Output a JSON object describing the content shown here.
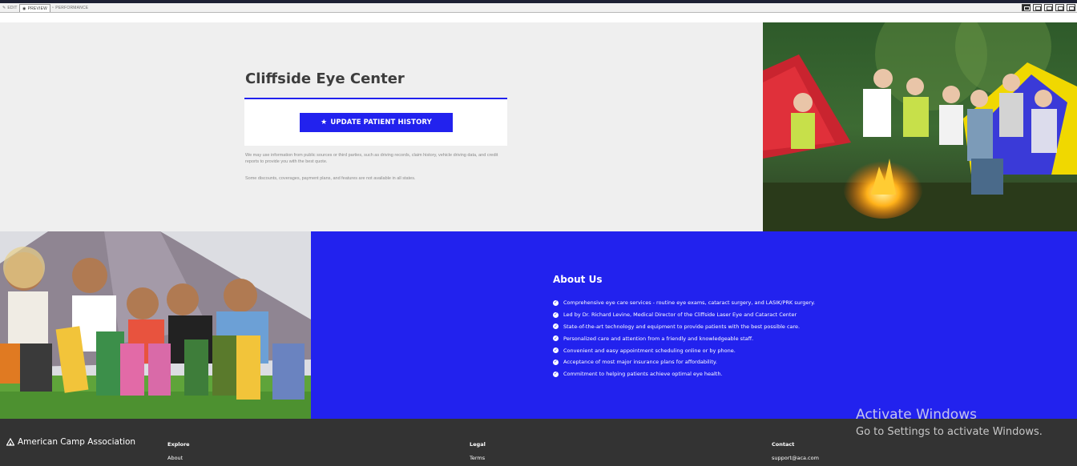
{
  "editor": {
    "tabs": [
      {
        "label": "EDIT",
        "icon": "pencil-icon"
      },
      {
        "label": "PREVIEW",
        "icon": "eye-icon",
        "active": true
      },
      {
        "label": "PERFORMANCE",
        "icon": "gauge-icon"
      }
    ],
    "device_icons": [
      "desktop-icon",
      "tablet-icon",
      "laptop-icon",
      "monitor-icon",
      "phone-icon"
    ]
  },
  "hero": {
    "title": "Cliffside Eye Center",
    "cta_label": "UPDATE PATIENT HISTORY",
    "cta_icon": "star-icon",
    "disclaimer1": "We may use information from public sources or third parties, such as driving records, claim history, vehicle driving data, and credit reports to provide you with the best quote.",
    "disclaimer2": "Some discounts, coverages, payment plans, and features are not available in all states."
  },
  "about": {
    "title": "About Us",
    "items": [
      "Comprehensive eye care services - routine eye exams, cataract surgery, and LASIK/PRK surgery.",
      "Led by Dr. Richard Levine, Medical Director of the Cliffside Laser Eye and Cataract Center",
      "State-of-the-art technology and equipment to provide patients with the best possible care.",
      "Personalized care and attention from a friendly and knowledgeable staff.",
      "Convenient and easy appointment scheduling online or by phone.",
      "Acceptance of most major insurance plans for affordability.",
      "Commitment to helping patients achieve optimal eye health."
    ]
  },
  "footer": {
    "brand": "American Camp Association",
    "explore": {
      "heading": "Explore",
      "link": "About"
    },
    "legal": {
      "heading": "Legal",
      "link": "Terms"
    },
    "contact": {
      "heading": "Contact",
      "link": "support@aca.com"
    }
  },
  "watermark": {
    "line1": "Activate Windows",
    "line2": "Go to Settings to activate Windows."
  },
  "colors": {
    "accent": "#2222ee",
    "footer_bg": "#333333",
    "hero_bg": "#efefef"
  }
}
